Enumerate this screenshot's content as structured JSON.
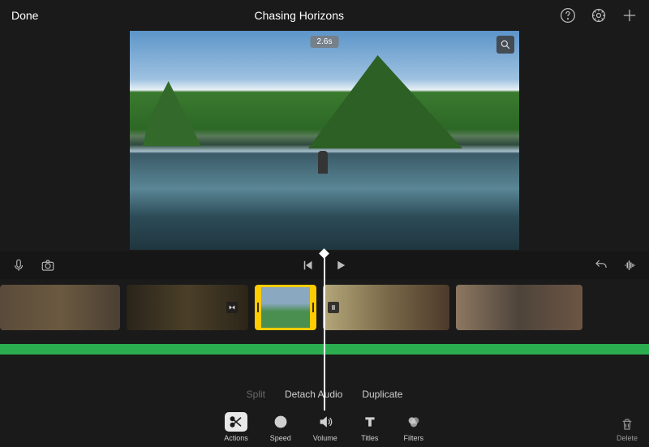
{
  "header": {
    "done_label": "Done",
    "title": "Chasing Horizons"
  },
  "preview": {
    "duration_badge": "2.6s"
  },
  "context_menu": {
    "split": "Split",
    "detach_audio": "Detach Audio",
    "duplicate": "Duplicate"
  },
  "toolbar": {
    "actions": "Actions",
    "speed": "Speed",
    "volume": "Volume",
    "titles": "Titles",
    "filters": "Filters"
  },
  "delete_label": "Delete"
}
